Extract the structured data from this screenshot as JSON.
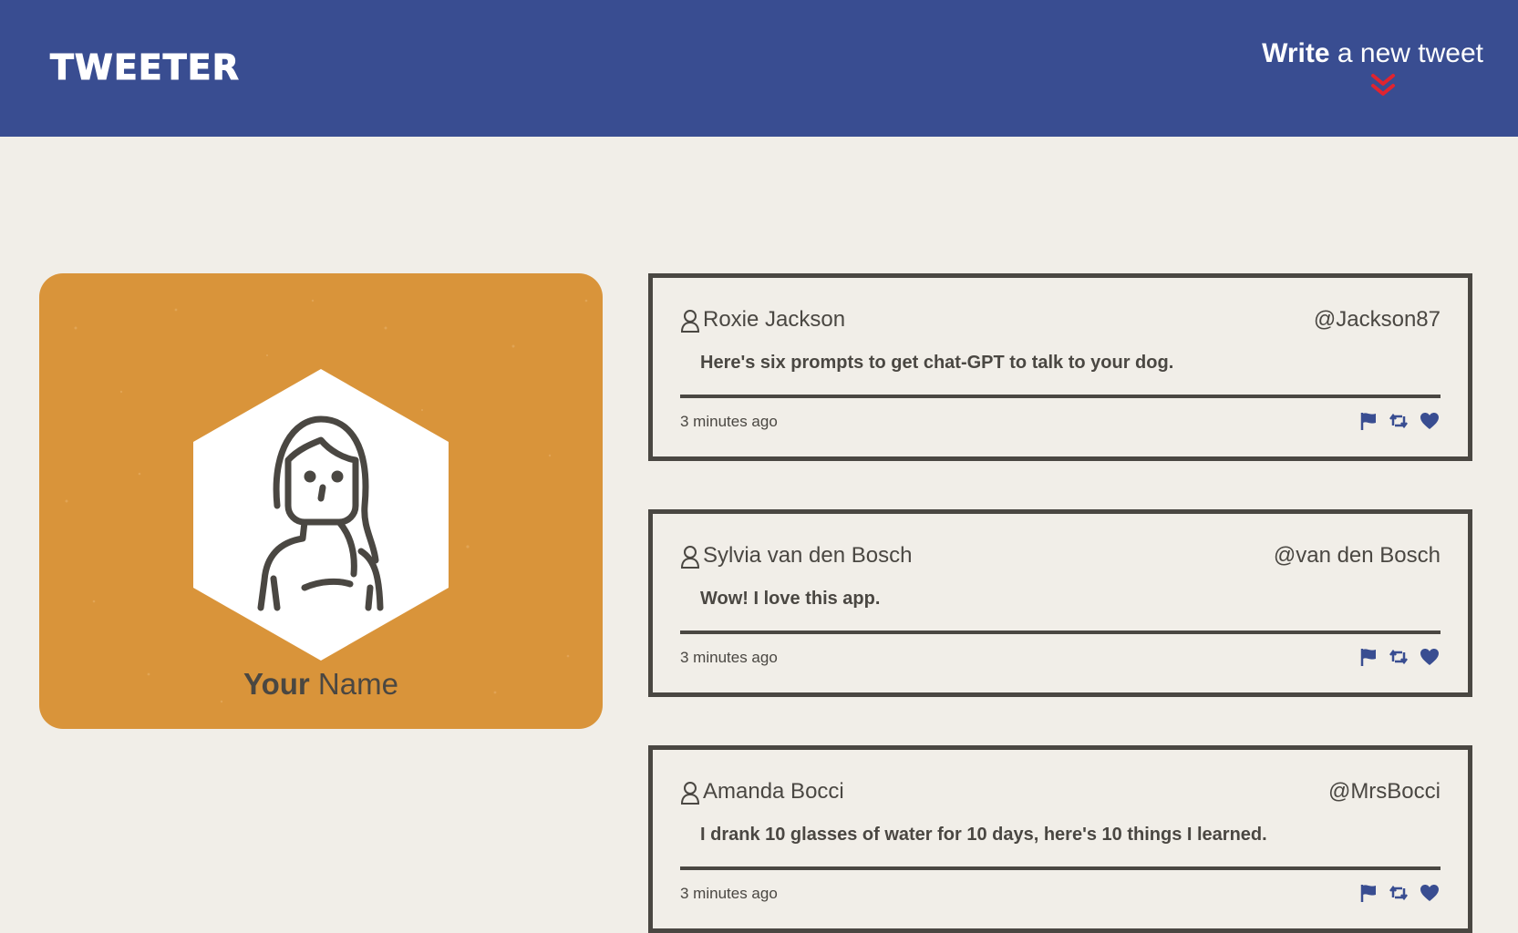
{
  "nav": {
    "brand": "TWEETER",
    "write_bold": "Write",
    "write_rest": " a new tweet"
  },
  "colors": {
    "nav_bg": "#394d91",
    "page_bg": "#f1eee8",
    "card_bg": "#d9943a",
    "text": "#4a4742",
    "chevron": "#e0242f",
    "icon_blue": "#394d91"
  },
  "profile": {
    "name_bold": "Your",
    "name_rest": " Name",
    "avatar_icon": "woman-avatar-icon"
  },
  "tweets": [
    {
      "name": "Roxie Jackson",
      "handle": "@Jackson87",
      "content": "Here's six prompts to get chat-GPT to talk to your dog.",
      "time": "3 minutes ago"
    },
    {
      "name": "Sylvia van den Bosch",
      "handle": "@van den Bosch",
      "content": "Wow! I love this app.",
      "time": "3 minutes ago"
    },
    {
      "name": "Amanda Bocci",
      "handle": "@MrsBocci",
      "content": "I drank 10 glasses of water for 10 days, here's 10 things I learned.",
      "time": "3 minutes ago"
    }
  ],
  "icons": {
    "user": "user-outline-icon",
    "flag": "flag-icon",
    "retweet": "retweet-icon",
    "like": "heart-icon",
    "scroll": "double-chevron-down-icon"
  }
}
